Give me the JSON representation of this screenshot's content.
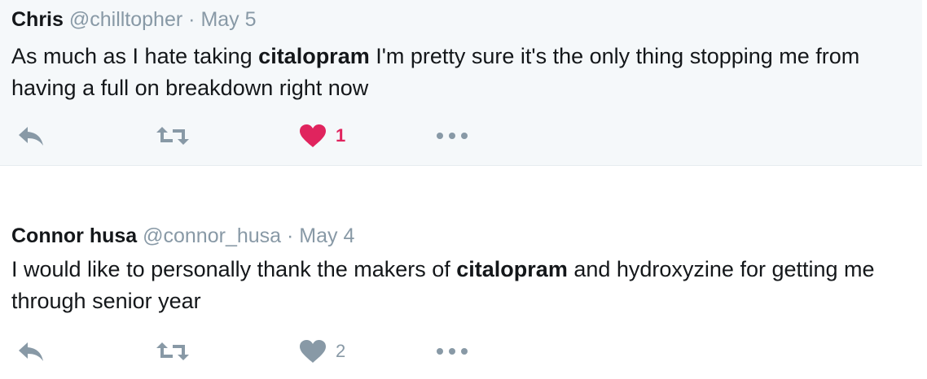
{
  "colors": {
    "muted": "#8899a6",
    "text": "#14171a",
    "like_active": "#e0245e",
    "highlight_bg": "#f5f8fa"
  },
  "tweets": [
    {
      "name": "Chris",
      "handle": "@chilltopher",
      "separator": "·",
      "date": "May 5",
      "text_parts": [
        "As much as I hate taking ",
        "citalopram",
        " I'm pretty sure it's the only thing stopping me from having a full on breakdown right now"
      ],
      "like_count": "1",
      "liked": true,
      "icons": [
        "reply-icon",
        "retweet-icon",
        "heart-icon",
        "more-icon"
      ]
    },
    {
      "name": "Connor husa",
      "handle": "@connor_husa",
      "separator": "·",
      "date": "May 4",
      "text_parts": [
        "I would like to personally thank the makers of ",
        "citalopram",
        " and hydroxyzine for getting me through senior year"
      ],
      "like_count": "2",
      "liked": false,
      "icons": [
        "reply-icon",
        "retweet-icon",
        "heart-icon",
        "more-icon"
      ]
    }
  ]
}
